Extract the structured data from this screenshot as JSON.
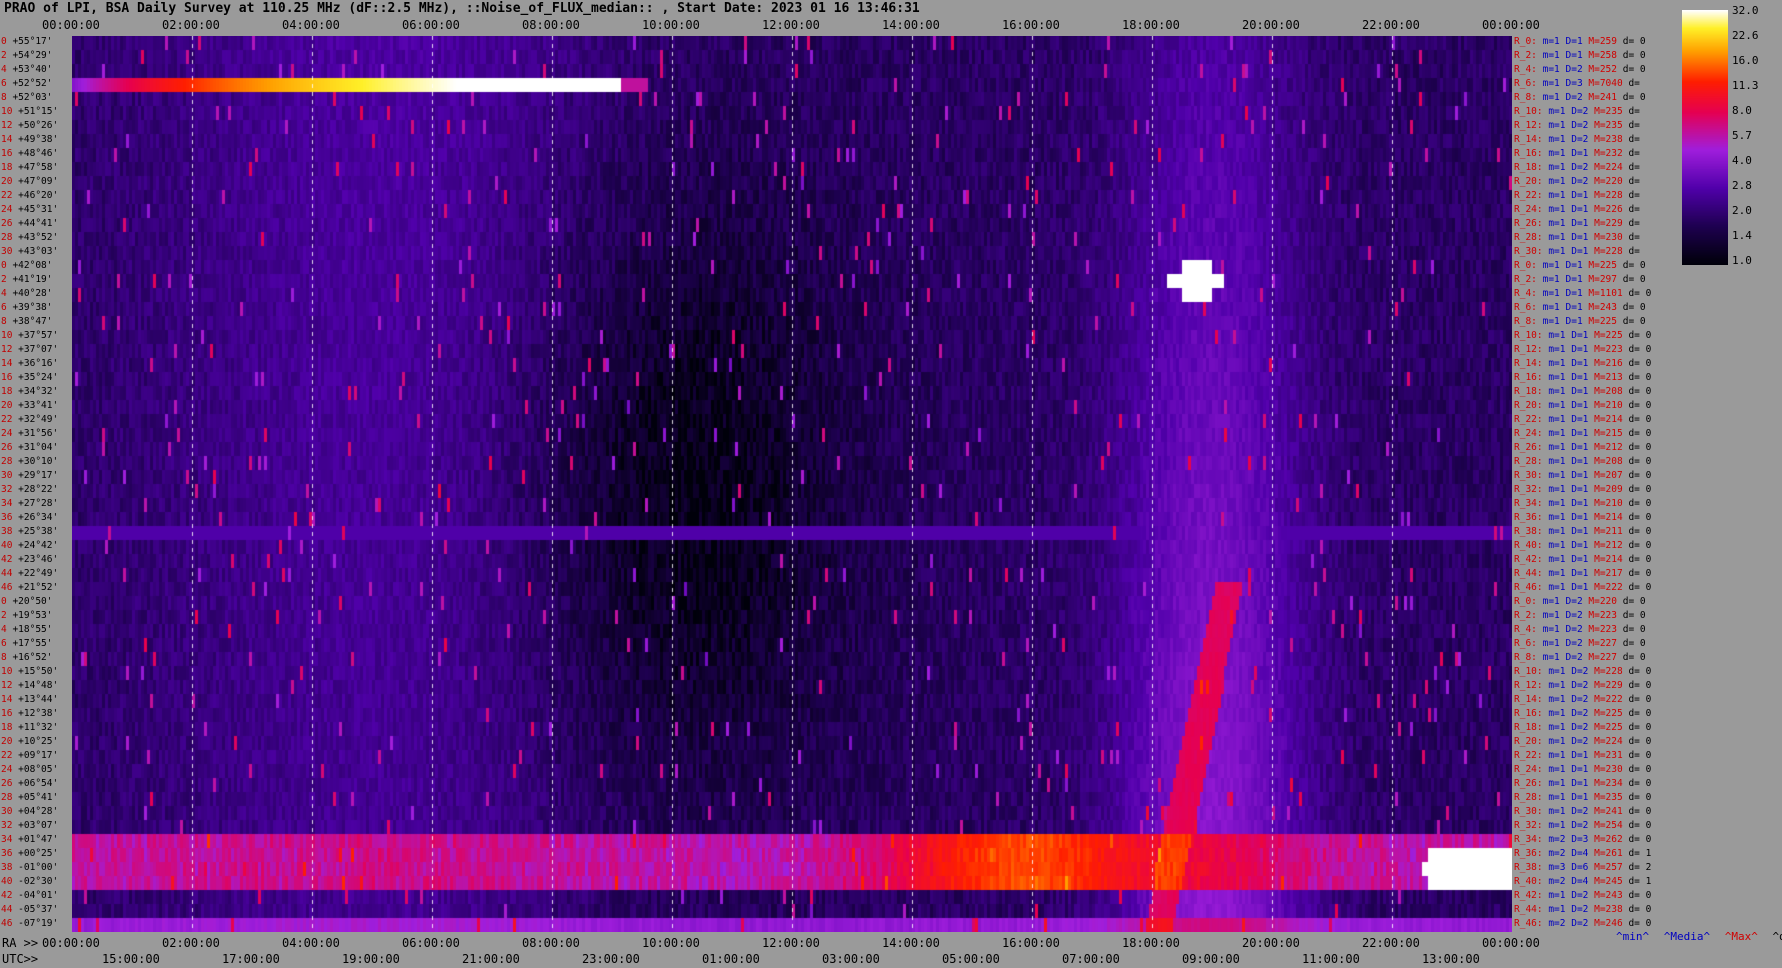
{
  "title": "PRAO of LPI, BSA Daily Survey at 110.25 MHz (dF::2.5 MHz), ::Noise_of_FLUX_median:: , Start Date: 2023 01 16 13:46:31",
  "top_time_ticks": [
    "00:00:00",
    "02:00:00",
    "04:00:00",
    "06:00:00",
    "08:00:00",
    "10:00:00",
    "12:00:00",
    "14:00:00",
    "16:00:00",
    "18:00:00",
    "20:00:00",
    "22:00:00",
    "00:00:00"
  ],
  "bottom_ra_label": "RA >>",
  "bottom_ra_ticks": [
    "00:00:00",
    "02:00:00",
    "04:00:00",
    "06:00:00",
    "08:00:00",
    "10:00:00",
    "12:00:00",
    "14:00:00",
    "16:00:00",
    "18:00:00",
    "20:00:00",
    "22:00:00",
    "00:00:00"
  ],
  "bottom_utc_label": "UTC>>",
  "bottom_utc_ticks": [
    "15:00:00",
    "17:00:00",
    "19:00:00",
    "21:00:00",
    "23:00:00",
    "01:00:00",
    "03:00:00",
    "05:00:00",
    "07:00:00",
    "09:00:00",
    "11:00:00",
    "13:00:00"
  ],
  "declinations": [
    "+55°17'",
    "+54°29'",
    "+53°40'",
    "+52°52'",
    "+52°03'",
    "+51°15'",
    "+50°26'",
    "+49°38'",
    "+48°46'",
    "+47°58'",
    "+47°09'",
    "+46°20'",
    "+45°31'",
    "+44°41'",
    "+43°52'",
    "+43°03'",
    "+42°08'",
    "+41°19'",
    "+40°28'",
    "+39°38'",
    "+38°47'",
    "+37°57'",
    "+37°07'",
    "+36°16'",
    "+35°24'",
    "+34°32'",
    "+33°41'",
    "+32°49'",
    "+31°56'",
    "+31°04'",
    "+30°10'",
    "+29°17'",
    "+28°22'",
    "+27°28'",
    "+26°34'",
    "+25°38'",
    "+24°42'",
    "+23°46'",
    "+22°49'",
    "+21°52'",
    "+20°50'",
    "+19°53'",
    "+18°55'",
    "+17°55'",
    "+16°52'",
    "+15°50'",
    "+14°48'",
    "+13°44'",
    "+12°38'",
    "+11°32'",
    "+10°25'",
    "+09°17'",
    "+08°05'",
    "+06°54'",
    "+05°41'",
    "+04°28'",
    "+03°07'",
    "+01°47'",
    "+00°25'",
    "-01°00'",
    "-02°30'",
    "-04°01'",
    "-05°37'",
    "-07°19'"
  ],
  "dec_indices": [
    "0",
    "2",
    "4",
    "6",
    "8",
    "10",
    "12",
    "14",
    "16",
    "18",
    "20",
    "22",
    "24",
    "26",
    "28",
    "30",
    "0",
    "2",
    "4",
    "6",
    "8",
    "10",
    "12",
    "14",
    "16",
    "18",
    "20",
    "22",
    "24",
    "26",
    "28",
    "30",
    "32",
    "34",
    "36",
    "38",
    "40",
    "42",
    "44",
    "46",
    "0",
    "2",
    "4",
    "6",
    "8",
    "10",
    "12",
    "14",
    "16",
    "18",
    "20",
    "22",
    "24",
    "26",
    "28",
    "30",
    "32",
    "34",
    "36",
    "38",
    "40",
    "42",
    "44",
    "46"
  ],
  "stats": [
    {
      "r": "R_0:",
      "m": "m=1",
      "d": "D=1",
      "M": "M=259",
      "dv": "d= 0"
    },
    {
      "r": "R_2:",
      "m": "m=1",
      "d": "D=1",
      "M": "M=258",
      "dv": "d= 0"
    },
    {
      "r": "R_4:",
      "m": "m=1",
      "d": "D=2",
      "M": "M=252",
      "dv": "d= 0"
    },
    {
      "r": "R_6:",
      "m": "m=1",
      "d": "D=3",
      "M": "M=7040",
      "dv": "d="
    },
    {
      "r": "R_8:",
      "m": "m=1",
      "d": "D=2",
      "M": "M=241",
      "dv": "d= 0"
    },
    {
      "r": "R_10:",
      "m": "m=1",
      "d": "D=2",
      "M": "M=235",
      "dv": "d="
    },
    {
      "r": "R_12:",
      "m": "m=1",
      "d": "D=2",
      "M": "M=235",
      "dv": "d="
    },
    {
      "r": "R_14:",
      "m": "m=1",
      "d": "D=2",
      "M": "M=238",
      "dv": "d="
    },
    {
      "r": "R_16:",
      "m": "m=1",
      "d": "D=1",
      "M": "M=232",
      "dv": "d="
    },
    {
      "r": "R_18:",
      "m": "m=1",
      "d": "D=2",
      "M": "M=224",
      "dv": "d="
    },
    {
      "r": "R_20:",
      "m": "m=1",
      "d": "D=2",
      "M": "M=220",
      "dv": "d="
    },
    {
      "r": "R_22:",
      "m": "m=1",
      "d": "D=1",
      "M": "M=228",
      "dv": "d="
    },
    {
      "r": "R_24:",
      "m": "m=1",
      "d": "D=1",
      "M": "M=226",
      "dv": "d="
    },
    {
      "r": "R_26:",
      "m": "m=1",
      "d": "D=1",
      "M": "M=229",
      "dv": "d="
    },
    {
      "r": "R_28:",
      "m": "m=1",
      "d": "D=1",
      "M": "M=230",
      "dv": "d="
    },
    {
      "r": "R_30:",
      "m": "m=1",
      "d": "D=1",
      "M": "M=228",
      "dv": "d="
    },
    {
      "r": "R_0:",
      "m": "m=1",
      "d": "D=1",
      "M": "M=225",
      "dv": "d= 0"
    },
    {
      "r": "R_2:",
      "m": "m=1",
      "d": "D=1",
      "M": "M=297",
      "dv": "d= 0"
    },
    {
      "r": "R_4:",
      "m": "m=1",
      "d": "D=1",
      "M": "M=1101",
      "dv": "d= 0"
    },
    {
      "r": "R_6:",
      "m": "m=1",
      "d": "D=1",
      "M": "M=243",
      "dv": "d= 0"
    },
    {
      "r": "R_8:",
      "m": "m=1",
      "d": "D=1",
      "M": "M=225",
      "dv": "d= 0"
    },
    {
      "r": "R_10:",
      "m": "m=1",
      "d": "D=1",
      "M": "M=225",
      "dv": "d= 0"
    },
    {
      "r": "R_12:",
      "m": "m=1",
      "d": "D=1",
      "M": "M=223",
      "dv": "d= 0"
    },
    {
      "r": "R_14:",
      "m": "m=1",
      "d": "D=1",
      "M": "M=216",
      "dv": "d= 0"
    },
    {
      "r": "R_16:",
      "m": "m=1",
      "d": "D=1",
      "M": "M=213",
      "dv": "d= 0"
    },
    {
      "r": "R_18:",
      "m": "m=1",
      "d": "D=1",
      "M": "M=208",
      "dv": "d= 0"
    },
    {
      "r": "R_20:",
      "m": "m=1",
      "d": "D=1",
      "M": "M=210",
      "dv": "d= 0"
    },
    {
      "r": "R_22:",
      "m": "m=1",
      "d": "D=1",
      "M": "M=214",
      "dv": "d= 0"
    },
    {
      "r": "R_24:",
      "m": "m=1",
      "d": "D=1",
      "M": "M=215",
      "dv": "d= 0"
    },
    {
      "r": "R_26:",
      "m": "m=1",
      "d": "D=1",
      "M": "M=212",
      "dv": "d= 0"
    },
    {
      "r": "R_28:",
      "m": "m=1",
      "d": "D=1",
      "M": "M=208",
      "dv": "d= 0"
    },
    {
      "r": "R_30:",
      "m": "m=1",
      "d": "D=1",
      "M": "M=207",
      "dv": "d= 0"
    },
    {
      "r": "R_32:",
      "m": "m=1",
      "d": "D=1",
      "M": "M=209",
      "dv": "d= 0"
    },
    {
      "r": "R_34:",
      "m": "m=1",
      "d": "D=1",
      "M": "M=210",
      "dv": "d= 0"
    },
    {
      "r": "R_36:",
      "m": "m=1",
      "d": "D=1",
      "M": "M=214",
      "dv": "d= 0"
    },
    {
      "r": "R_38:",
      "m": "m=1",
      "d": "D=1",
      "M": "M=211",
      "dv": "d= 0"
    },
    {
      "r": "R_40:",
      "m": "m=1",
      "d": "D=1",
      "M": "M=212",
      "dv": "d= 0"
    },
    {
      "r": "R_42:",
      "m": "m=1",
      "d": "D=1",
      "M": "M=214",
      "dv": "d= 0"
    },
    {
      "r": "R_44:",
      "m": "m=1",
      "d": "D=1",
      "M": "M=217",
      "dv": "d= 0"
    },
    {
      "r": "R_46:",
      "m": "m=1",
      "d": "D=1",
      "M": "M=222",
      "dv": "d= 0"
    },
    {
      "r": "R_0:",
      "m": "m=1",
      "d": "D=2",
      "M": "M=220",
      "dv": "d= 0"
    },
    {
      "r": "R_2:",
      "m": "m=1",
      "d": "D=2",
      "M": "M=223",
      "dv": "d= 0"
    },
    {
      "r": "R_4:",
      "m": "m=1",
      "d": "D=2",
      "M": "M=223",
      "dv": "d= 0"
    },
    {
      "r": "R_6:",
      "m": "m=1",
      "d": "D=2",
      "M": "M=227",
      "dv": "d= 0"
    },
    {
      "r": "R_8:",
      "m": "m=1",
      "d": "D=2",
      "M": "M=227",
      "dv": "d= 0"
    },
    {
      "r": "R_10:",
      "m": "m=1",
      "d": "D=2",
      "M": "M=228",
      "dv": "d= 0"
    },
    {
      "r": "R_12:",
      "m": "m=1",
      "d": "D=2",
      "M": "M=229",
      "dv": "d= 0"
    },
    {
      "r": "R_14:",
      "m": "m=1",
      "d": "D=2",
      "M": "M=222",
      "dv": "d= 0"
    },
    {
      "r": "R_16:",
      "m": "m=1",
      "d": "D=2",
      "M": "M=225",
      "dv": "d= 0"
    },
    {
      "r": "R_18:",
      "m": "m=1",
      "d": "D=2",
      "M": "M=225",
      "dv": "d= 0"
    },
    {
      "r": "R_20:",
      "m": "m=1",
      "d": "D=2",
      "M": "M=224",
      "dv": "d= 0"
    },
    {
      "r": "R_22:",
      "m": "m=1",
      "d": "D=1",
      "M": "M=231",
      "dv": "d= 0"
    },
    {
      "r": "R_24:",
      "m": "m=1",
      "d": "D=1",
      "M": "M=230",
      "dv": "d= 0"
    },
    {
      "r": "R_26:",
      "m": "m=1",
      "d": "D=1",
      "M": "M=234",
      "dv": "d= 0"
    },
    {
      "r": "R_28:",
      "m": "m=1",
      "d": "D=1",
      "M": "M=235",
      "dv": "d= 0"
    },
    {
      "r": "R_30:",
      "m": "m=1",
      "d": "D=2",
      "M": "M=241",
      "dv": "d= 0"
    },
    {
      "r": "R_32:",
      "m": "m=1",
      "d": "D=2",
      "M": "M=254",
      "dv": "d= 0"
    },
    {
      "r": "R_34:",
      "m": "m=2",
      "d": "D=3",
      "M": "M=262",
      "dv": "d= 0"
    },
    {
      "r": "R_36:",
      "m": "m=2",
      "d": "D=4",
      "M": "M=261",
      "dv": "d= 1"
    },
    {
      "r": "R_38:",
      "m": "m=3",
      "d": "D=6",
      "M": "M=257",
      "dv": "d= 2"
    },
    {
      "r": "R_40:",
      "m": "m=2",
      "d": "D=4",
      "M": "M=245",
      "dv": "d= 1"
    },
    {
      "r": "R_42:",
      "m": "m=1",
      "d": "D=2",
      "M": "M=243",
      "dv": "d= 0"
    },
    {
      "r": "R_44:",
      "m": "m=1",
      "d": "D=2",
      "M": "M=238",
      "dv": "d= 0"
    },
    {
      "r": "R_46:",
      "m": "m=2",
      "d": "D=2",
      "M": "M=246",
      "dv": "d= 0"
    }
  ],
  "colorbar_labels": [
    "32.0",
    "22.6",
    "16.0",
    "11.3",
    "8.0",
    "5.7",
    "4.0",
    "2.8",
    "2.0",
    "1.4",
    "1.0"
  ],
  "legend": {
    "min": "^min^",
    "median": "^Media^",
    "max": "^Max^",
    "dev": "^devia^"
  },
  "colors": {
    "min": "#0000c0",
    "median": "#0000c0",
    "max": "#d00000",
    "dev": "#000000"
  },
  "chart_data": {
    "type": "heatmap",
    "title": "PRAO of LPI, BSA Daily Survey at 110.25 MHz (dF::2.5 MHz), ::Noise_of_FLUX_median:: , Start Date: 2023 01 16 13:46:31",
    "x_axis": "RA 00:00:00 to 24:00:00",
    "y_axis": "Declination +55°17' to -07°19'",
    "rows": 64,
    "colorscale_range": [
      1.0,
      32.0
    ],
    "colorscale": "log, black-purple-red-yellow-white",
    "features": [
      {
        "kind": "horizontal_bright_streak",
        "dec": "+52°52'",
        "ra_from": "00:00:00",
        "ra_to": "10:40:00",
        "level": 32
      },
      {
        "kind": "horizontal_band",
        "dec_from": "+01°47'",
        "dec_to": "-02°30'",
        "level": 8
      },
      {
        "kind": "horizontal_band",
        "dec": "-07°19'",
        "level": 6
      },
      {
        "kind": "horizontal_line",
        "dec": "+25°38'",
        "level": 3
      },
      {
        "kind": "bright_source",
        "ra": "20:00:00",
        "dec": "+40°28'",
        "level": 32
      },
      {
        "kind": "bright_source",
        "ra": "23:20:00",
        "dec": "-01°00'",
        "level": 32
      },
      {
        "kind": "galactic_plane_ridge",
        "ra": "19:00:00-21:00:00",
        "level": 6
      }
    ]
  }
}
